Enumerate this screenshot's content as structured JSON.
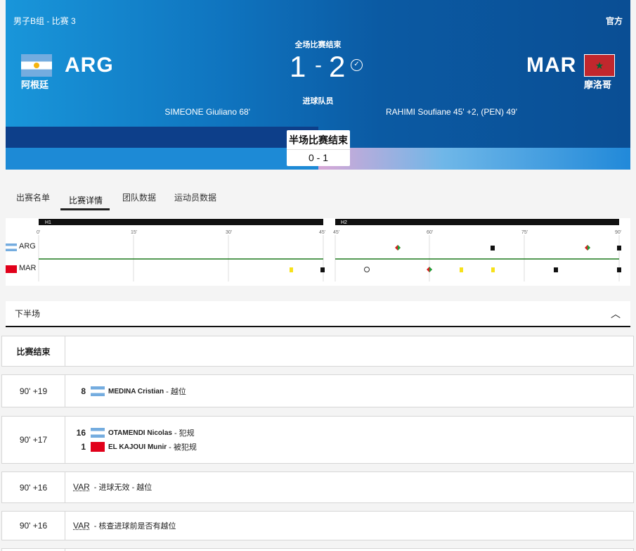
{
  "header": {
    "group": "男子B组 - 比赛 3",
    "official": "官方",
    "status": "全场比赛结束",
    "scorers_label": "进球队员",
    "home": {
      "code": "ARG",
      "name": "阿根廷",
      "score": "1",
      "scorers": "SIMEONE Giuliano 68'"
    },
    "away": {
      "code": "MAR",
      "name": "摩洛哥",
      "score": "2",
      "scorers": "RAHIMI Soufiane 45' +2, (PEN) 49'"
    },
    "dash": "-",
    "halftime": {
      "label": "半场比赛结束",
      "score": "0 - 1"
    }
  },
  "tabs": [
    {
      "label": "出赛名单"
    },
    {
      "label": "比赛详情",
      "active": true
    },
    {
      "label": "团队数据"
    },
    {
      "label": "运动员数据"
    }
  ],
  "timeline": {
    "halves": [
      {
        "label": "H1",
        "ticks": [
          "0'",
          "15'",
          "30'",
          "45'"
        ]
      },
      {
        "label": "H2",
        "ticks": [
          "45'",
          "60'",
          "75'",
          "90'"
        ]
      }
    ],
    "teams": [
      "ARG",
      "MAR"
    ]
  },
  "section": {
    "title": "下半场"
  },
  "events": [
    {
      "time": "比赛结束",
      "lines": []
    },
    {
      "time": "90' +19",
      "lines": [
        {
          "num": "8",
          "team": "arg",
          "player": "MEDINA Cristian",
          "desc": "- 越位"
        }
      ]
    },
    {
      "time": "90' +17",
      "lines": [
        {
          "num": "16",
          "team": "arg",
          "player": "OTAMENDI Nicolas",
          "desc": "- 犯规"
        },
        {
          "num": "1",
          "team": "mar",
          "player": "EL KAJOUI Munir",
          "desc": "- 被犯规"
        }
      ]
    },
    {
      "time": "90' +16",
      "var": "VAR",
      "desc": "- 进球无效 - 越位"
    },
    {
      "time": "90' +16",
      "var": "VAR",
      "desc": "- 核查进球前是否有越位"
    }
  ],
  "colors": {
    "header_blue": "#0f74bf",
    "pitch_line": "#1d7a1d",
    "yellow_card": "#f7e11a"
  }
}
